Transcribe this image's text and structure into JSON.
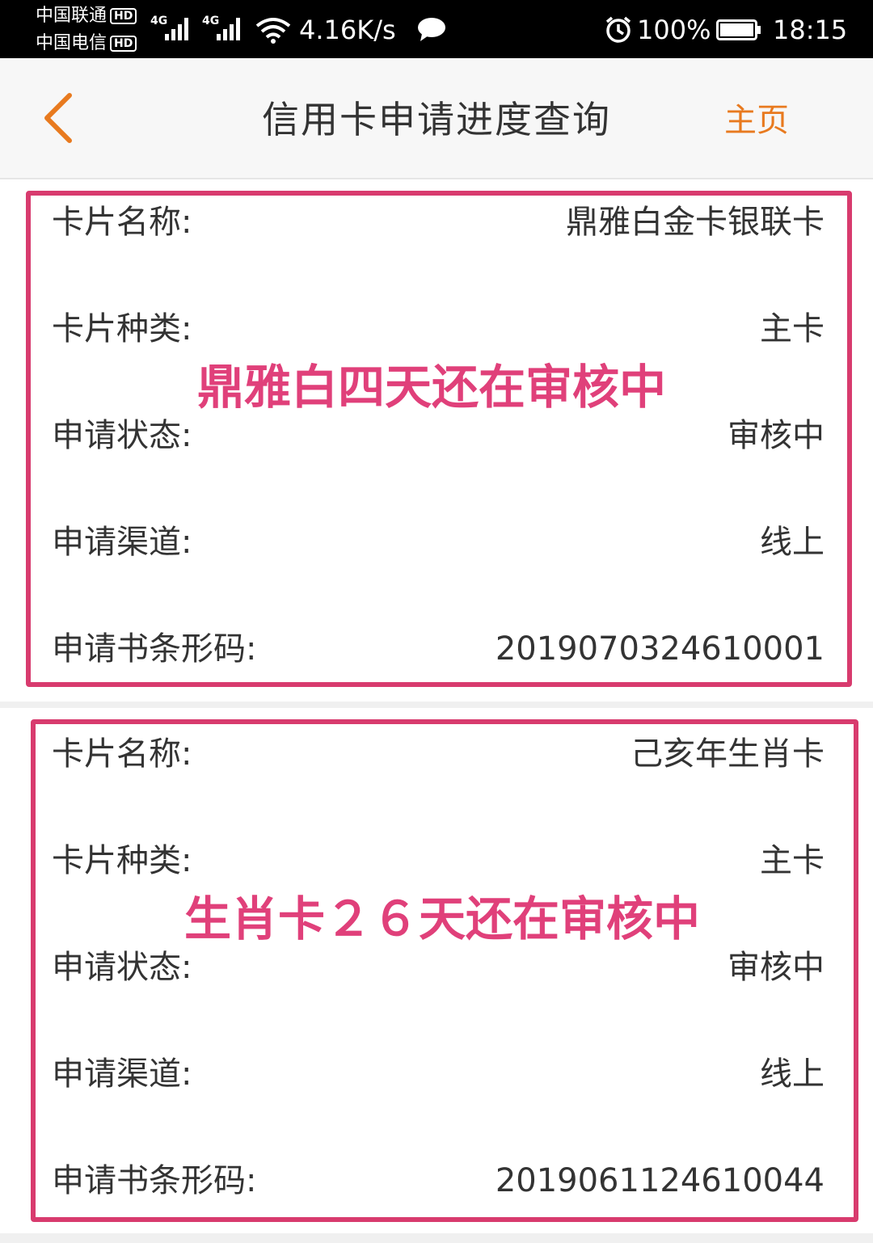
{
  "status_bar": {
    "carrier_1": "中国联通",
    "carrier_2": "中国电信",
    "hd_badge": "HD",
    "network_type": "4G",
    "net_speed": "4.16K/s",
    "battery": "100%",
    "time": "18:15",
    "icons": [
      "signal-icon",
      "wifi-icon",
      "chat-icon",
      "alarm-icon",
      "battery-icon"
    ]
  },
  "nav": {
    "title": "信用卡申请进度查询",
    "home_label": "主页",
    "accent_color": "#e87a1f"
  },
  "cards": [
    {
      "rows": [
        {
          "label": "卡片名称:",
          "value": "鼎雅白金卡银联卡"
        },
        {
          "label": "卡片种类:",
          "value": "主卡"
        },
        {
          "label": "申请状态:",
          "value": "审核中"
        },
        {
          "label": "申请渠道:",
          "value": "线上"
        },
        {
          "label": "申请书条形码:",
          "value": "2019070324610001"
        }
      ],
      "annotation": "鼎雅白四天还在审核中"
    },
    {
      "rows": [
        {
          "label": "卡片名称:",
          "value": "己亥年生肖卡"
        },
        {
          "label": "卡片种类:",
          "value": "主卡"
        },
        {
          "label": "申请状态:",
          "value": "审核中"
        },
        {
          "label": "申请渠道:",
          "value": "线上"
        },
        {
          "label": "申请书条形码:",
          "value": "2019061124610044"
        }
      ],
      "annotation": "生肖卡２６天还在审核中"
    }
  ],
  "annotation_color": "#d83b6e"
}
